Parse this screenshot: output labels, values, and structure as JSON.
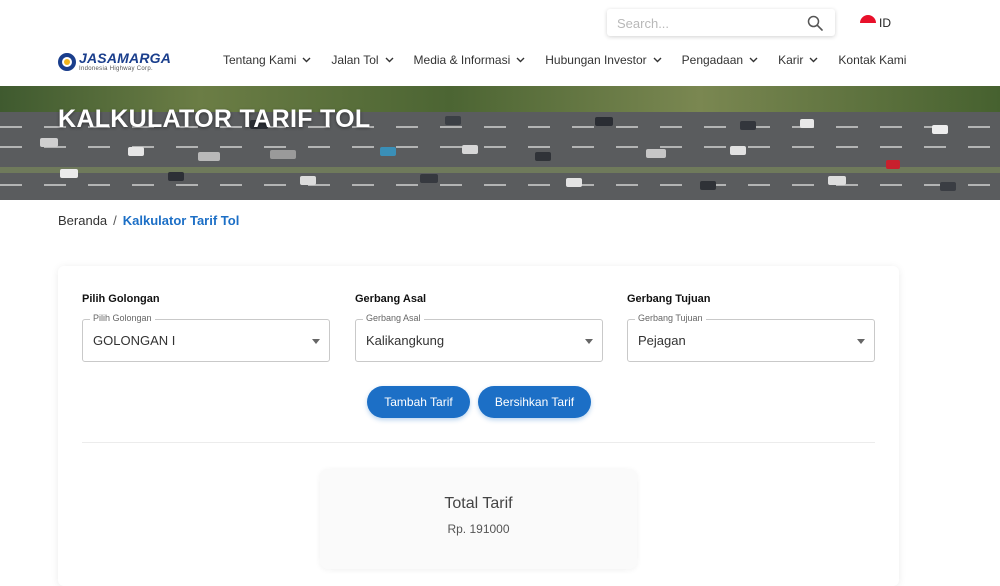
{
  "header": {
    "search_placeholder": "Search...",
    "language": "ID",
    "flag_color": "#e8102a",
    "logo": {
      "name": "JASAMARGA",
      "tagline": "Indonesia Highway Corp."
    },
    "nav": [
      {
        "label": "Tentang Kami",
        "has_dropdown": true
      },
      {
        "label": "Jalan Tol",
        "has_dropdown": true
      },
      {
        "label": "Media & Informasi",
        "has_dropdown": true
      },
      {
        "label": "Hubungan Investor",
        "has_dropdown": true
      },
      {
        "label": "Pengadaan",
        "has_dropdown": true
      },
      {
        "label": "Karir",
        "has_dropdown": true
      },
      {
        "label": "Kontak Kami",
        "has_dropdown": false
      }
    ]
  },
  "hero": {
    "title": "KALKULATOR TARIF TOL"
  },
  "breadcrumb": {
    "home": "Beranda",
    "separator": "/",
    "current": "Kalkulator Tarif Tol"
  },
  "calculator": {
    "golongan": {
      "label": "Pilih Golongan",
      "legend": "Pilih Golongan",
      "value": "GOLONGAN I"
    },
    "asal": {
      "label": "Gerbang Asal",
      "legend": "Gerbang Asal",
      "value": "Kalikangkung"
    },
    "tujuan": {
      "label": "Gerbang Tujuan",
      "legend": "Gerbang Tujuan",
      "value": "Pejagan"
    },
    "add_button": "Tambah Tarif",
    "clear_button": "Bersihkan Tarif",
    "total_title": "Total Tarif",
    "total_value": "Rp. 191000"
  },
  "colors": {
    "accent": "#1c6fc6",
    "brand": "#1a3e8c"
  }
}
